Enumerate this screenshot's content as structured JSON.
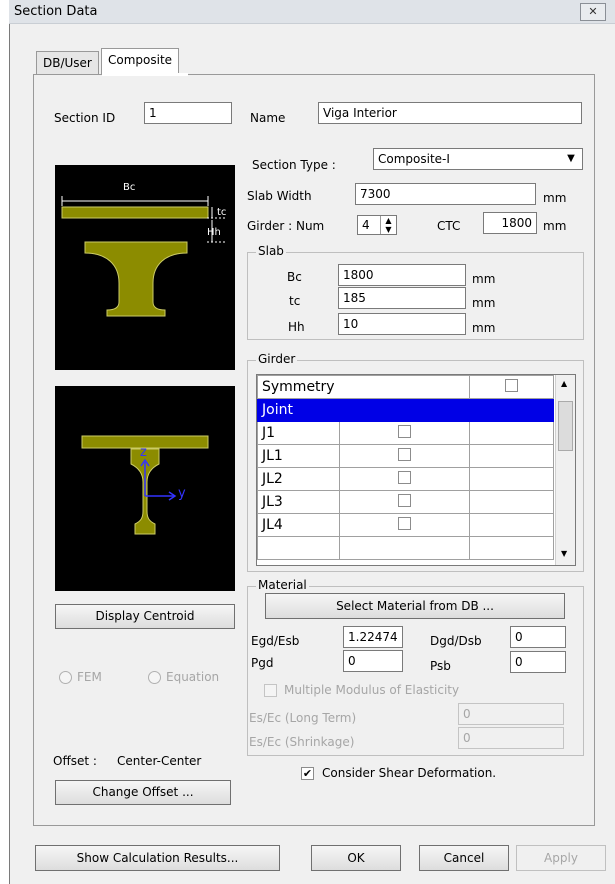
{
  "window": {
    "title": "Section Data",
    "close_glyph": "✕"
  },
  "tabs": [
    {
      "label": "DB/User"
    },
    {
      "label": "Composite"
    }
  ],
  "section_id": {
    "label": "Section ID",
    "value": "1"
  },
  "name": {
    "label": "Name",
    "value": "Viga Interior"
  },
  "section_type": {
    "label": "Section Type :",
    "value": "Composite-I"
  },
  "slab_width": {
    "label": "Slab Width",
    "value": "7300",
    "unit": "mm"
  },
  "girder_num": {
    "label": "Girder : Num",
    "value": "4",
    "ctc_label": "CTC",
    "ctc_value": "1800",
    "ctc_unit": "mm"
  },
  "slab": {
    "title": "Slab",
    "rows": [
      {
        "label": "Bc",
        "value": "1800",
        "unit": "mm"
      },
      {
        "label": "tc",
        "value": "185",
        "unit": "mm"
      },
      {
        "label": "Hh",
        "value": "10",
        "unit": "mm"
      }
    ]
  },
  "diagram": {
    "bc_label": "Bc",
    "tc_label": "tc",
    "hh_label": "Hh",
    "axis_z": "z",
    "axis_y": "y",
    "colors": {
      "girder": "#8c8c00",
      "background": "#000000",
      "axis": "#3333ff"
    }
  },
  "girder": {
    "title": "Girder",
    "symmetry_label": "Symmetry",
    "joint_label": "Joint",
    "rows": [
      "J1",
      "JL1",
      "JL2",
      "JL3",
      "JL4"
    ],
    "highlight_color": "#0000e6"
  },
  "material": {
    "title": "Material",
    "select_button": "Select Material from DB ...",
    "egd_label": "Egd/Esb",
    "egd_value": "1.22474",
    "dgd_label": "Dgd/Dsb",
    "dgd_value": "0",
    "pgd_label": "Pgd",
    "pgd_value": "0",
    "psb_label": "Psb",
    "psb_value": "0",
    "multi_modulus": "Multiple Modulus of Elasticity",
    "es_long_label": "Es/Ec (Long Term)",
    "es_long_value": "0",
    "es_shrink_label": "Es/Ec (Shrinkage)",
    "es_shrink_value": "0"
  },
  "display_centroid": "Display Centroid",
  "radio_fem": "FEM",
  "radio_equation": "Equation",
  "offset": {
    "label": "Offset :",
    "value": "Center-Center",
    "button": "Change Offset ..."
  },
  "shear": {
    "label": "Consider Shear Deformation.",
    "checked": true
  },
  "footer": {
    "show_results": "Show Calculation Results...",
    "ok": "OK",
    "cancel": "Cancel",
    "apply": "Apply"
  }
}
